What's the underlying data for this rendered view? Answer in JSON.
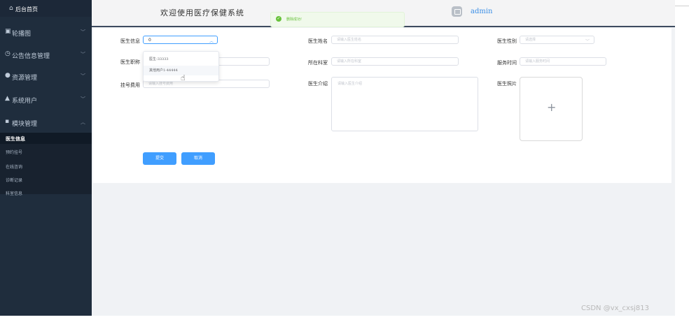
{
  "sidebar": {
    "home": {
      "icon": "home-icon",
      "label": "后台首页"
    },
    "menus": [
      {
        "icon": "image-icon",
        "label": "轮播图",
        "chevron": "﹀"
      },
      {
        "icon": "clock-icon",
        "label": "公告信息管理",
        "chevron": "﹀"
      },
      {
        "icon": "location-icon",
        "label": "资源管理",
        "chevron": "﹀"
      },
      {
        "icon": "user-icon",
        "label": "系统用户",
        "chevron": "﹀"
      },
      {
        "icon": "grid-icon",
        "label": "模块管理",
        "chevron": "︿"
      }
    ],
    "submenu": [
      "医生信息",
      "预约挂号",
      "在线咨询",
      "诊断记录",
      "科室信息"
    ]
  },
  "header": {
    "welcome": "欢迎使用医疗保健系统",
    "user": "admin",
    "toast": "删除成功!"
  },
  "form": {
    "labels": {
      "doctor_info": "医生信息",
      "doctor_title": "医生职称",
      "fee": "挂号费用",
      "doctor_name": "医生姓名",
      "department": "所在科室",
      "intro": "医生介绍",
      "gender": "医生性别",
      "service_time": "服务时间",
      "photo": "医生照片"
    },
    "values": {
      "doctor_info": "0"
    },
    "placeholders": {
      "fee": "请输入挂号费用",
      "doctor_name": "请输入医生姓名",
      "department": "请输入所在科室",
      "intro": "请输入医生介绍",
      "gender": "请选择",
      "service_time": "请输入服务时间"
    },
    "dropdown_options": [
      "医生-33333",
      "其他用户1-44444"
    ],
    "upload_plus": "+",
    "submit": "提交",
    "cancel": "取消"
  },
  "watermark": "CSDN @vx_cxsj813",
  "colors": {
    "primary": "#409eff",
    "sidebar": "#1f2d3d",
    "success": "#67c23a"
  }
}
